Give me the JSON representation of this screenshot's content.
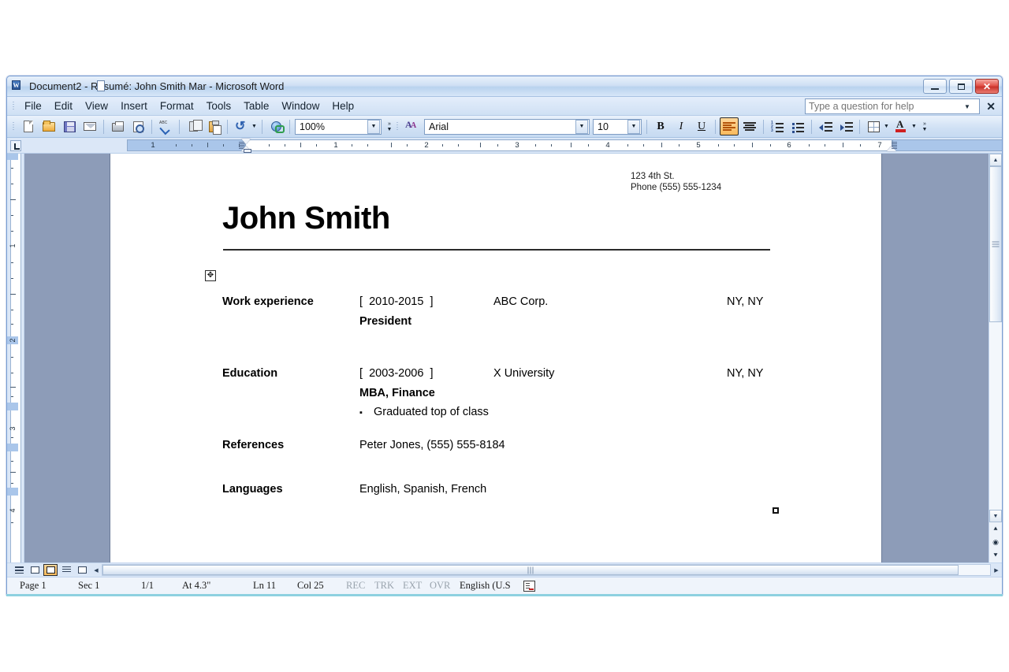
{
  "window": {
    "title": "Document2 - Résumé: John Smith Mar - Microsoft Word",
    "app_icon": "word-icon",
    "minimize_label": "Minimize",
    "restore_label": "Restore",
    "close_label": "Close"
  },
  "menu": {
    "items": [
      {
        "label": "File",
        "accel": "F"
      },
      {
        "label": "Edit",
        "accel": "E"
      },
      {
        "label": "View",
        "accel": "V"
      },
      {
        "label": "Insert",
        "accel": "I"
      },
      {
        "label": "Format",
        "accel": "o"
      },
      {
        "label": "Tools",
        "accel": "T"
      },
      {
        "label": "Table",
        "accel": "a"
      },
      {
        "label": "Window",
        "accel": "W"
      },
      {
        "label": "Help",
        "accel": "H"
      }
    ],
    "help_placeholder": "Type a question for help"
  },
  "toolbar": {
    "standard": [
      {
        "name": "new-document-icon",
        "label": "New Blank Document"
      },
      {
        "name": "open-folder-icon",
        "label": "Open"
      },
      {
        "name": "save-icon",
        "label": "Save"
      },
      {
        "name": "mail-recipient-icon",
        "label": "E-mail"
      },
      {
        "name": "print-icon",
        "label": "Print"
      },
      {
        "name": "print-preview-icon",
        "label": "Print Preview"
      },
      {
        "name": "spelling-grammar-icon",
        "label": "Spelling and Grammar"
      },
      {
        "name": "copy-icon",
        "label": "Copy"
      },
      {
        "name": "paste-icon",
        "label": "Paste"
      },
      {
        "name": "undo-icon",
        "label": "Undo"
      },
      {
        "name": "insert-hyperlink-icon",
        "label": "Insert Hyperlink"
      }
    ],
    "zoom_value": "100%",
    "formatting": {
      "font_name": "Arial",
      "font_size": "10",
      "bold_label": "B",
      "italic_label": "I",
      "underline_label": "U",
      "align_left_label": "Align Left",
      "align_center_label": "Center",
      "numbering_label": "Numbering",
      "bullets_label": "Bullets",
      "decrease_indent_label": "Decrease Indent",
      "increase_indent_label": "Increase Indent",
      "borders_label": "Borders",
      "font_color_label": "Font Color",
      "font_color_hex": "#d02020",
      "active_button": "align-left"
    }
  },
  "ruler": {
    "tab_selector": "L",
    "horizontal_numbers": [
      "1",
      "1",
      "2",
      "3",
      "4",
      "5",
      "6",
      "7"
    ],
    "vertical_numbers": [
      "1",
      "2",
      "3",
      "4"
    ]
  },
  "document": {
    "header_address_line1": "123 4th St.",
    "header_address_line2": "Phone (555) 555-1234",
    "name": "John Smith",
    "sections": [
      {
        "label": "Work experience",
        "dates": "[  2010-2015  ]",
        "organization": "ABC Corp.",
        "location": "NY, NY",
        "subtitle": "President",
        "bullets": []
      },
      {
        "label": "Education",
        "dates": "[  2003-2006  ]",
        "organization": "X University",
        "location": "NY, NY",
        "subtitle": "MBA, Finance",
        "bullets": [
          "Graduated top of class"
        ]
      },
      {
        "label": "References",
        "text": "Peter Jones, (555) 555-8184"
      },
      {
        "label": "Languages",
        "text": "English, Spanish, French"
      }
    ]
  },
  "view_buttons": [
    {
      "name": "normal-view-button",
      "label": "Normal View"
    },
    {
      "name": "web-layout-view-button",
      "label": "Web Layout View"
    },
    {
      "name": "print-layout-view-button",
      "label": "Print Layout View"
    },
    {
      "name": "outline-view-button",
      "label": "Outline View"
    },
    {
      "name": "reading-layout-view-button",
      "label": "Reading Layout"
    }
  ],
  "statusbar": {
    "page": "Page 1",
    "section": "Sec 1",
    "page_of": "1/1",
    "at": "At 4.3\"",
    "line": "Ln 11",
    "column": "Col 25",
    "rec": "REC",
    "trk": "TRK",
    "ext": "EXT",
    "ovr": "OVR",
    "language": "English (U.S",
    "spell_icon": "spelling-status-icon"
  }
}
